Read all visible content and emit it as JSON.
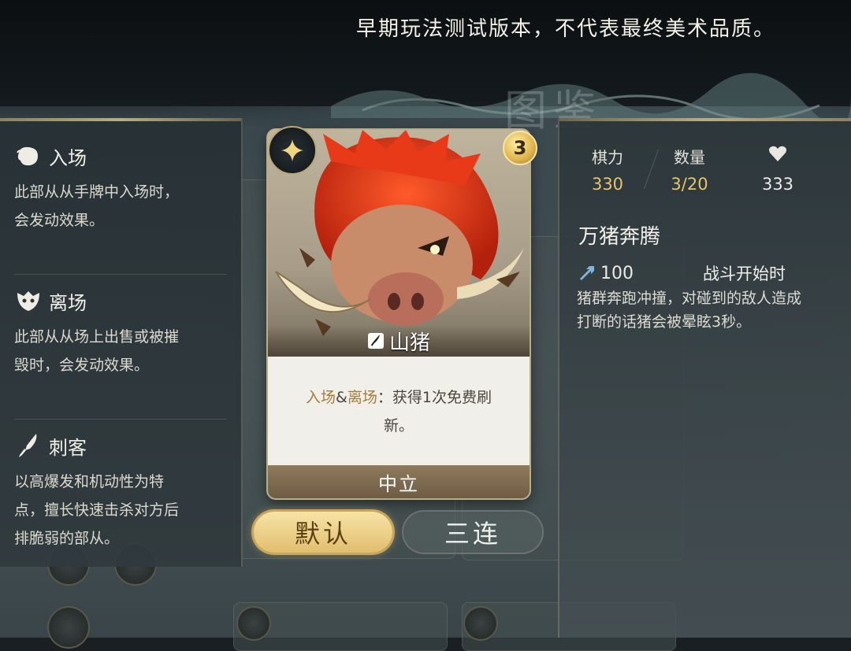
{
  "watermark": "早期玩法测试版本，不代表最终美术品质。",
  "screen_title": "图鉴",
  "keywords": [
    {
      "title": "入场",
      "icon": "fist-icon",
      "desc": [
        "此部从从手牌中入场时，",
        "会发动效果。"
      ]
    },
    {
      "title": "离场",
      "icon": "mask-icon",
      "desc": [
        "此部从从场上出售或被摧",
        "毁时，会发动效果。"
      ]
    },
    {
      "title": "刺客",
      "icon": "dagger-icon",
      "desc": [
        "以高爆发和机动性为特",
        "点，擅长快速击杀对方后",
        "排脆弱的部从。"
      ]
    }
  ],
  "card": {
    "name": "山猪",
    "tier": "3",
    "effect_keyword_1": "入场",
    "effect_amp": "&",
    "effect_keyword_2": "离场",
    "effect_text_1": "：获得1次免费刷",
    "effect_text_2": "新。",
    "faction": "中立"
  },
  "buttons": {
    "default_label": "默认",
    "triple_label": "三连"
  },
  "stats": {
    "power_label": "棋力",
    "power_value": "330",
    "count_label": "数量",
    "count_value": "3/20",
    "health_icon": "heart-icon",
    "health_value": "333"
  },
  "skill": {
    "name": "万猪奔腾",
    "cooldown": "100",
    "trigger": "战斗开始时",
    "desc": [
      "猪群奔跑冲撞，对碰到的敌人造成",
      "打断的话猪会被晕眩3秒。"
    ]
  },
  "colors": {
    "gold": "#e7c46a",
    "keyword_highlight": "#a77d3c"
  }
}
